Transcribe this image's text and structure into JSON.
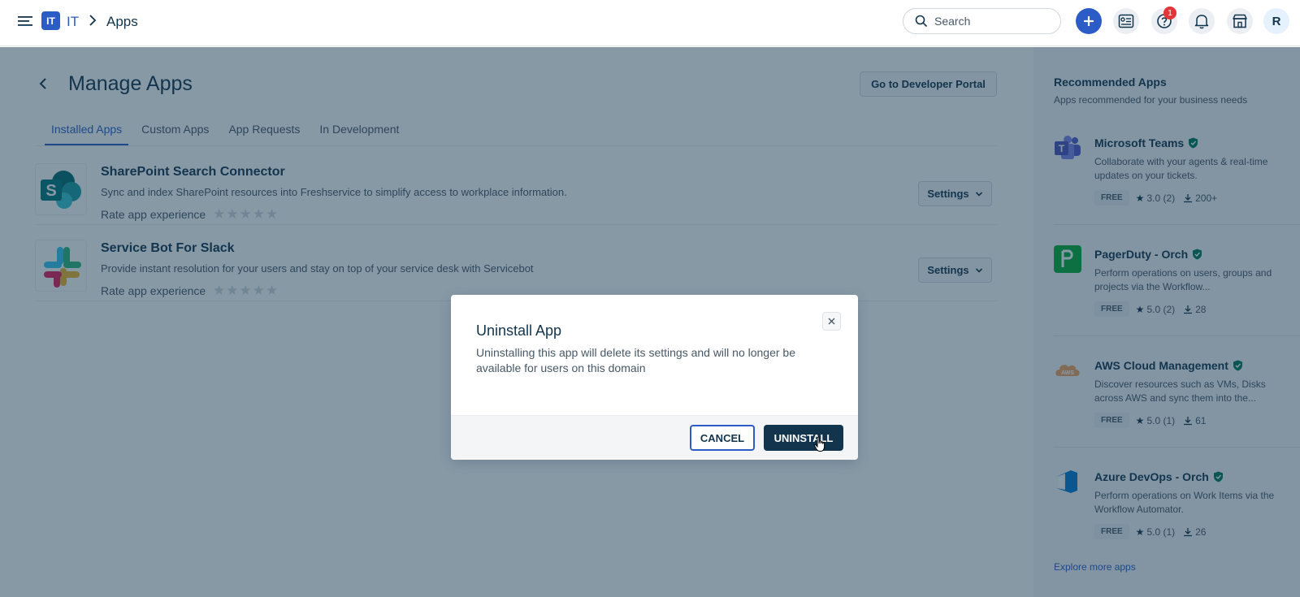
{
  "header": {
    "workspace_badge": "IT",
    "workspace_name": "IT",
    "current_page": "Apps",
    "search_placeholder": "Search",
    "help_badge_count": "1",
    "avatar_initial": "R"
  },
  "page": {
    "title": "Manage Apps",
    "developer_portal_label": "Go to Developer Portal",
    "tabs": [
      {
        "label": "Installed Apps",
        "active": true
      },
      {
        "label": "Custom Apps",
        "active": false
      },
      {
        "label": "App Requests",
        "active": false
      },
      {
        "label": "In Development",
        "active": false
      }
    ],
    "apps": [
      {
        "name": "SharePoint Search Connector",
        "description": "Sync and index SharePoint resources into Freshservice to simplify access to workplace information.",
        "rate_label": "Rate app experience",
        "stars": "★★★★★",
        "settings_label": "Settings",
        "icon": "sharepoint-icon"
      },
      {
        "name": "Service Bot For Slack",
        "description": "Provide instant resolution for your users and stay on top of your service desk with Servicebot",
        "rate_label": "Rate app experience",
        "stars": "★★★★★",
        "settings_label": "Settings",
        "icon": "slack-icon"
      }
    ]
  },
  "recommended": {
    "title": "Recommended Apps",
    "subtitle": "Apps recommended for your business needs",
    "items": [
      {
        "name": "Microsoft Teams",
        "description": "Collaborate with your agents & real-time updates on your tickets.",
        "tag": "FREE",
        "rating": "3.0 (2)",
        "installs": "200+",
        "icon": "microsoft-teams-icon",
        "color": "#5059c9"
      },
      {
        "name": "PagerDuty - Orch",
        "description": "Perform operations on users, groups and projects via the Workflow...",
        "tag": "FREE",
        "rating": "5.0 (2)",
        "installs": "28",
        "icon": "pagerduty-icon",
        "color": "#06ac38"
      },
      {
        "name": "AWS Cloud Management",
        "description": "Discover resources such as VMs, Disks across AWS and sync them into the...",
        "tag": "FREE",
        "rating": "5.0 (1)",
        "installs": "61",
        "icon": "aws-icon",
        "color": "#f0a35e"
      },
      {
        "name": "Azure DevOps - Orch",
        "description": "Perform operations on Work Items via the Workflow Automator.",
        "tag": "FREE",
        "rating": "5.0 (1)",
        "installs": "26",
        "icon": "azure-devops-icon",
        "color": "#0078d4"
      }
    ],
    "explore_label": "Explore more apps"
  },
  "modal": {
    "title": "Uninstall App",
    "body": "Uninstalling this app will delete its settings and will no longer be available for users on this domain",
    "cancel_label": "CANCEL",
    "confirm_label": "UNINSTALL"
  }
}
